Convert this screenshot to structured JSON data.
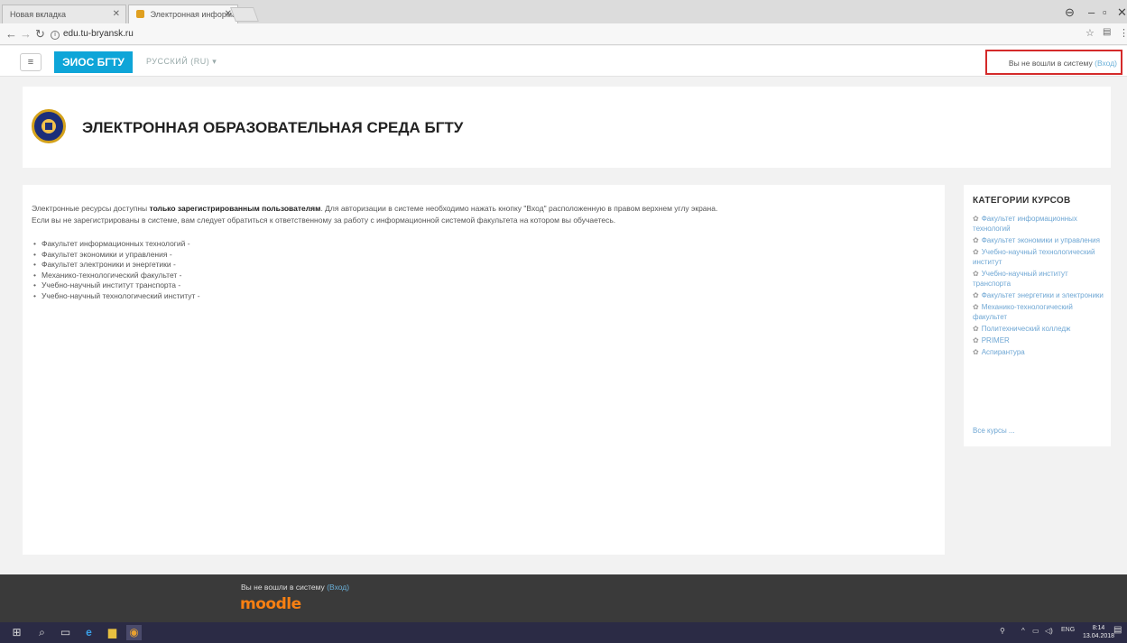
{
  "browser": {
    "tabs": [
      {
        "label": "Новая вкладка",
        "active": false
      },
      {
        "label": "Электронная информац",
        "active": true
      }
    ],
    "url": "edu.tu-bryansk.ru"
  },
  "navbar": {
    "menu_icon": "≡",
    "brand": "ЭИОС БГТУ",
    "language": "РУССКИЙ (RU) ▾",
    "login_text": "Вы не вошли в систему",
    "login_link": "(Вход)"
  },
  "header": {
    "title": "ЭЛЕКТРОННАЯ ОБРАЗОВАТЕЛЬНАЯ СРЕДА БГТУ"
  },
  "main": {
    "intro_prefix": "Электронные ресурсы доступны ",
    "intro_bold": "только зарегистрированным пользователям",
    "intro_suffix": ". Для авторизации в системе необходимо нажать кнопку \"Вход\" расположенную в правом верхнем углу экрана.",
    "intro_line2": "Если вы не зарегистрированы в системе, вам следует обратиться к ответственному за работу с информационной системой факультета на котором вы обучаетесь.",
    "faculties": [
      "Факультет информационных технологий -",
      "Факультет экономики и управления -",
      "Факультет электроники и энергетики -",
      "Механико-технологический факультет -",
      "Учебно-научный институт транспорта -",
      "Учебно-научный технологический институт -"
    ]
  },
  "sidebar": {
    "title": "КАТЕГОРИИ КУРСОВ",
    "categories": [
      "Факультет информационных технологий",
      "Факультет экономики и управления",
      "Учебно-научный технологический институт",
      "Учебно-научный институт транспорта",
      "Факультет энергетики и электроники",
      "Механико-технологический факультет",
      "Политехнический колледж",
      "PRIMER",
      "Аспирантура"
    ],
    "all_courses": "Все курсы ..."
  },
  "footer": {
    "login_text": "Вы не вошли в систему",
    "login_link": "(Вход)",
    "logo": "moodle"
  },
  "taskbar": {
    "lang": "ENG",
    "time": "8:14",
    "date": "13.04.2018"
  }
}
